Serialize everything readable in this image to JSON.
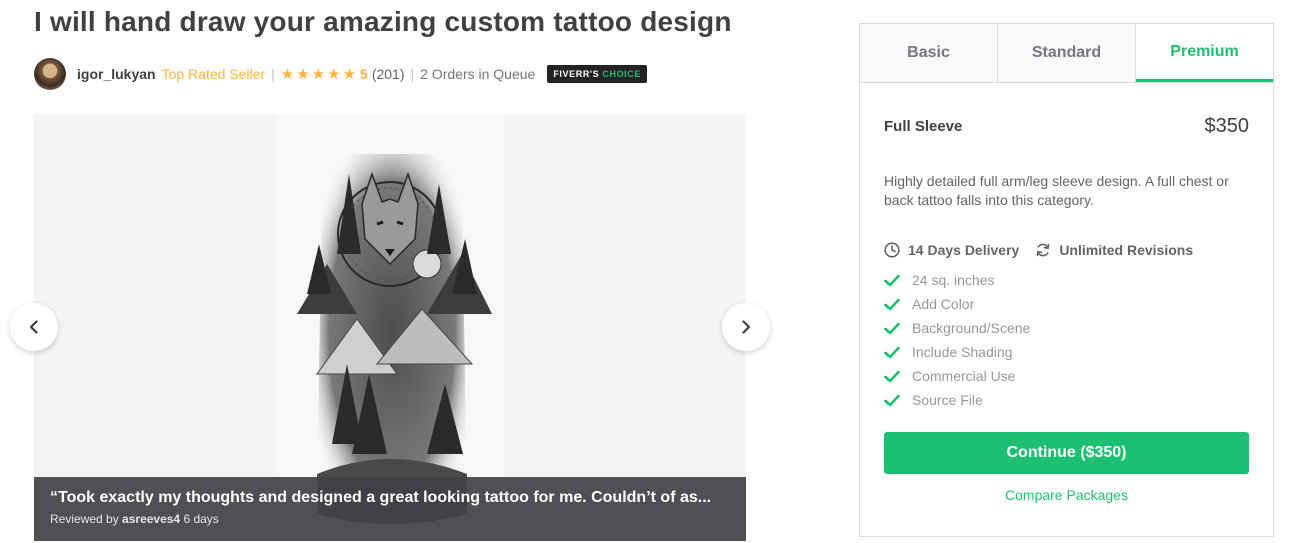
{
  "gig": {
    "title": "I will hand draw your amazing custom tattoo design"
  },
  "seller": {
    "username": "igor_lukyan",
    "level": "Top Rated Seller",
    "separator": "|",
    "rating_score": "5",
    "rating_count": "(201)",
    "stars": 5,
    "orders_in_queue": "2 Orders in Queue",
    "badge_main": "FIVERR'S",
    "badge_accent": "CHOICE"
  },
  "gallery": {
    "review_quote": "“Took exactly my thoughts and designed a great looking tattoo for me. Couldn’t of as...",
    "reviewed_by_label": "Reviewed by",
    "reviewer": "asreeves4",
    "review_age": "6 days",
    "prev_icon": "chevron-left-icon",
    "next_icon": "chevron-right-icon"
  },
  "packages": {
    "tabs": [
      {
        "label": "Basic",
        "active": false
      },
      {
        "label": "Standard",
        "active": false
      },
      {
        "label": "Premium",
        "active": true
      }
    ],
    "selected": {
      "name": "Full Sleeve",
      "price": "$350",
      "description": "Highly detailed full arm/leg sleeve design. A full chest or back tattoo falls into this category.",
      "delivery": "14 Days Delivery",
      "revisions": "Unlimited Revisions",
      "features": [
        "24 sq. inches",
        "Add Color",
        "Background/Scene",
        "Include Shading",
        "Commercial Use",
        "Source File"
      ]
    },
    "continue_label": "Continue ($350)",
    "compare_label": "Compare Packages"
  },
  "colors": {
    "brand_green": "#1dbf73",
    "star_gold": "#ffb33e",
    "text_dark": "#404145",
    "text_muted": "#95979d"
  }
}
